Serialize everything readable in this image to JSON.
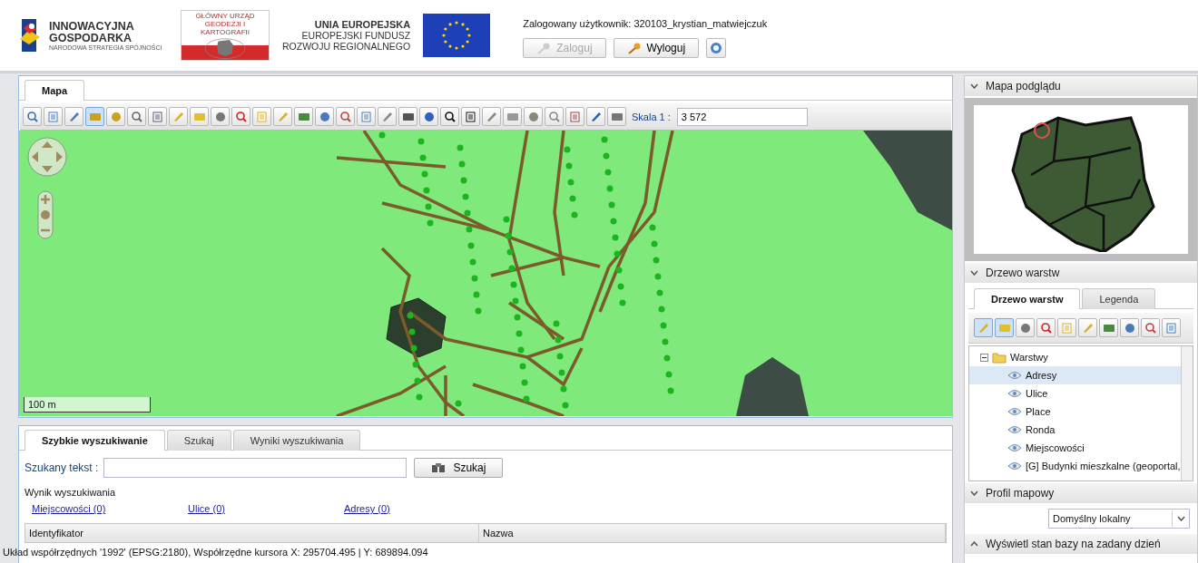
{
  "header": {
    "logo_innowacyjna": {
      "line_1": "INNOWACYJNA",
      "line_2": "GOSPODARKA",
      "tagline": "NARODOWA STRATEGIA SPÓJNOŚCI"
    },
    "logo_gugik": {
      "caption": "GŁÓWNY URZĄD GEODEZJI I KARTOGRAFII"
    },
    "logo_ue": {
      "line_1": "UNIA EUROPEJSKA",
      "line_2": "EUROPEJSKI FUNDUSZ",
      "line_3": "ROZWOJU REGIONALNEGO"
    },
    "user": "Zalogowany użytkownik: 320103_krystian_matwiejczuk",
    "buttons": [
      {
        "label": "Zaloguj",
        "disabled": true
      },
      {
        "label": "Wyloguj",
        "disabled": false
      }
    ]
  },
  "map_panel": {
    "tabs": [
      {
        "label": "Mapa",
        "selected": true
      }
    ],
    "tools": [
      {
        "selected": false
      },
      {
        "selected": false
      },
      {
        "selected": false
      },
      {
        "selected": true
      },
      {
        "selected": false
      },
      {
        "selected": false
      },
      {
        "selected": false
      },
      {
        "selected": false
      },
      {
        "selected": false
      },
      {
        "selected": false
      },
      {
        "selected": false
      },
      {
        "selected": false
      },
      {
        "selected": false
      },
      {
        "selected": false
      },
      {
        "selected": false
      },
      {
        "selected": false
      },
      {
        "selected": false
      },
      {
        "selected": false
      },
      {
        "selected": false
      },
      {
        "selected": false
      },
      {
        "selected": false
      },
      {
        "selected": false
      },
      {
        "selected": false
      },
      {
        "selected": false
      },
      {
        "selected": false
      },
      {
        "selected": false
      },
      {
        "selected": false
      },
      {
        "selected": false
      },
      {
        "selected": false
      }
    ],
    "scale_label": "Skala 1 :",
    "scale_value": "3 572",
    "scale_bar": "100 m"
  },
  "search_panel": {
    "tabs": [
      {
        "label": "Szybkie wyszukiwanie",
        "selected": true
      },
      {
        "label": "Szukaj",
        "selected": false
      },
      {
        "label": "Wyniki wyszukiwania",
        "selected": false
      }
    ],
    "field_label": "Szukany tekst :",
    "search_button": "Szukaj",
    "results_title": "Wynik wyszukiwania",
    "result_links": [
      "Miejscowości (0)",
      "Ulice (0)",
      "Adresy (0)"
    ],
    "columns": [
      "Identyfikator",
      "Nazwa"
    ]
  },
  "status_bar": "Układ współrzędnych '1992' (EPSG:2180), Współrzędne kursora X: 295704.495 | Y: 689894.094",
  "sidebar": {
    "preview": {
      "title": "Mapa podglądu",
      "expanded": true
    },
    "layers": {
      "title": "Drzewo warstw",
      "expanded": true,
      "tabs": [
        {
          "label": "Drzewo warstw",
          "selected": true
        },
        {
          "label": "Legenda",
          "selected": false
        }
      ],
      "tools": [
        {
          "selected": true
        },
        {
          "selected": true
        },
        {
          "selected": false
        },
        {
          "selected": false
        },
        {
          "selected": false
        },
        {
          "selected": false
        },
        {
          "selected": false
        },
        {
          "selected": false
        },
        {
          "selected": false
        },
        {
          "selected": false
        }
      ],
      "tree": [
        {
          "label": "Warstwy",
          "expanded": true,
          "children": [
            {
              "label": "Adresy",
              "selected": true
            },
            {
              "label": "Ulice",
              "selected": false
            },
            {
              "label": "Place",
              "selected": false
            },
            {
              "label": "Ronda",
              "selected": false
            },
            {
              "label": "Miejscowości",
              "selected": false
            },
            {
              "label": "[G] Budynki mieszkalne (geoportal,",
              "selected": false
            }
          ]
        }
      ]
    },
    "profile": {
      "title": "Profil mapowy",
      "expanded": true,
      "value": "Domyślny lokalny"
    },
    "history": {
      "title": "Wyświetl stan bazy na zadany dzień",
      "expanded": false
    }
  }
}
